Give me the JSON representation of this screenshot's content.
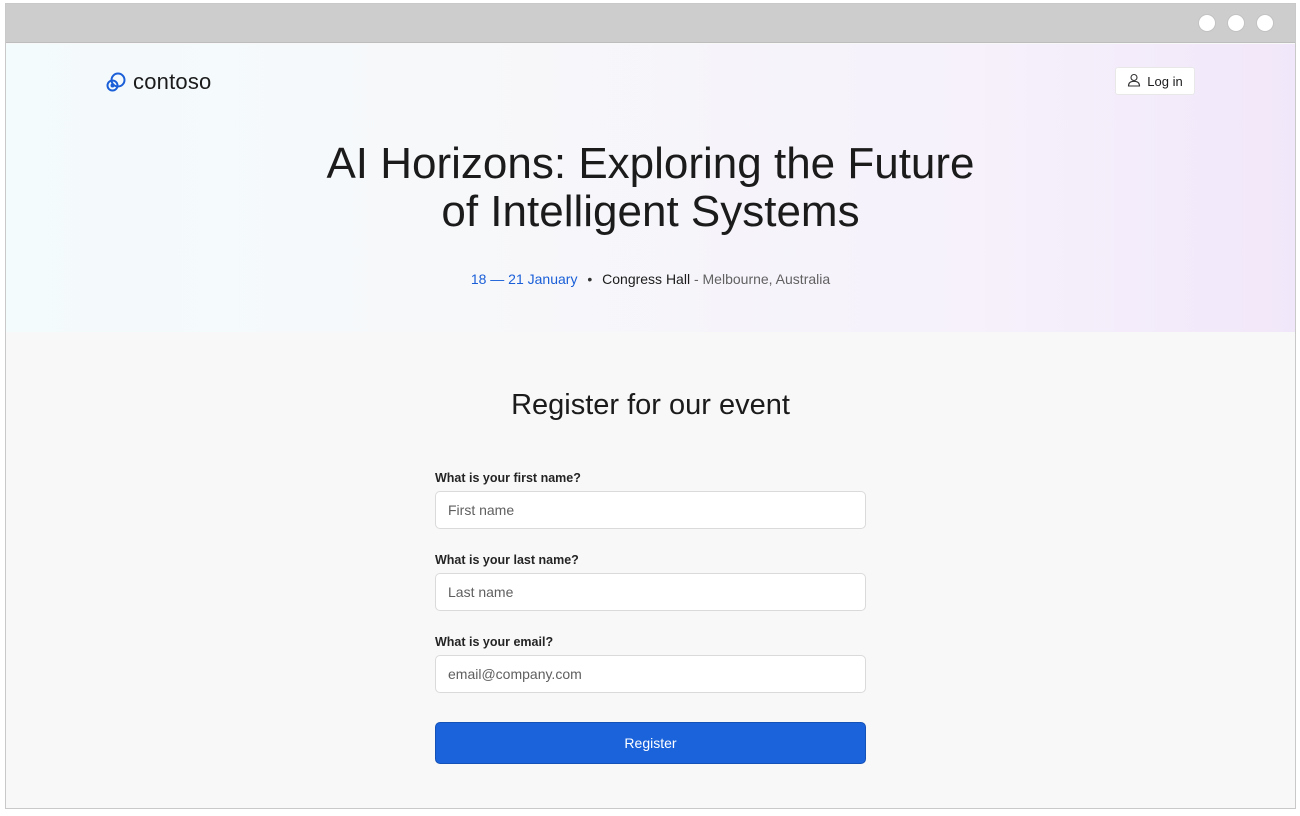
{
  "brand": {
    "name": "contoso",
    "logo_icon": "contoso-logo-icon",
    "color": "#1a5fd8"
  },
  "header": {
    "login_label": "Log in",
    "login_icon": "person-icon"
  },
  "hero": {
    "title_line1": "AI Horizons: Exploring the Future",
    "title_line2": "of Intelligent Systems",
    "dates": "18 — 21 January",
    "separator": "•",
    "venue": "Congress Hall",
    "location": "- Melbourne, Australia"
  },
  "register": {
    "title": "Register for our event",
    "fields": [
      {
        "label": "What is your first name?",
        "placeholder": "First name",
        "value": ""
      },
      {
        "label": "What is your last name?",
        "placeholder": "Last name",
        "value": ""
      },
      {
        "label": "What is your email?",
        "placeholder": "email@company.com",
        "value": ""
      }
    ],
    "submit_label": "Register",
    "accent": "#1a63db"
  }
}
